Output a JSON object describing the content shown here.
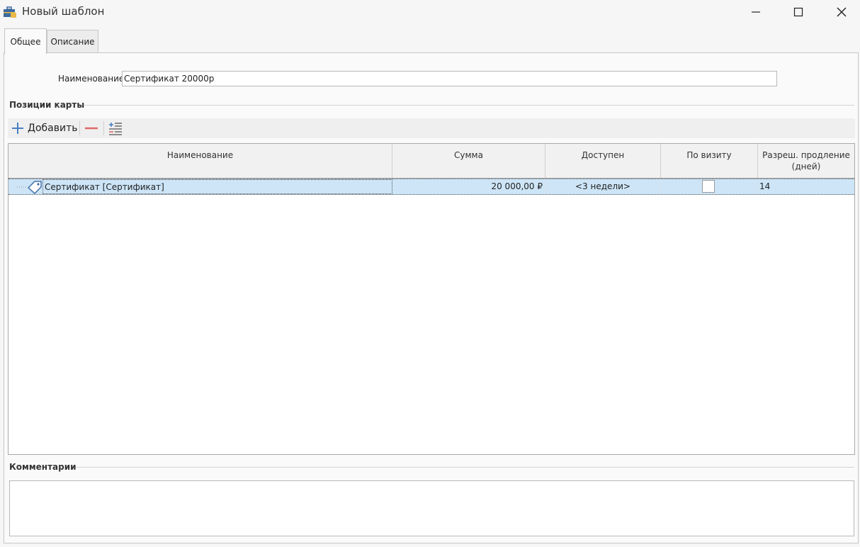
{
  "window": {
    "title": "Новый шаблон"
  },
  "tabs": [
    {
      "label": "Общее",
      "active": true
    },
    {
      "label": "Описание",
      "active": false
    }
  ],
  "form": {
    "name_label": "Наименование:",
    "name_value": "Сертификат 20000р"
  },
  "positions": {
    "section_title": "Позиции карты",
    "toolbar": {
      "add_label": "Добавить"
    },
    "columns": [
      "Наименование",
      "Сумма",
      "Доступен",
      "По визиту",
      "Разреш. продление\n(дней)"
    ],
    "rows": [
      {
        "name": "Сертификат [Сертификат]",
        "sum": "20 000,00 ₽",
        "available": "<3 недели>",
        "by_visit": false,
        "extension_days": "14"
      }
    ]
  },
  "comments": {
    "section_title": "Комментарии",
    "value": ""
  },
  "colors": {
    "selected_row": "#cde5f7",
    "add_icon": "#4a7fc1",
    "remove_icon": "#e06a6a"
  }
}
